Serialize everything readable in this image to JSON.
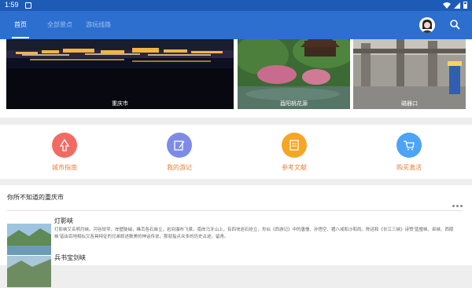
{
  "status_bar": {
    "time": "1:59"
  },
  "tabs": [
    {
      "label": "首页",
      "active": true
    },
    {
      "label": "全部景点",
      "active": false
    },
    {
      "label": "游玩线路",
      "active": false
    }
  ],
  "carousel": [
    {
      "caption": "重庆市"
    },
    {
      "caption": "酉阳桃花源"
    },
    {
      "caption": "磁器口"
    }
  ],
  "features": [
    {
      "label": "城市指南",
      "color": "#f26b63",
      "icon": "city-guide-icon"
    },
    {
      "label": "我的游记",
      "color": "#7d8be8",
      "icon": "travel-notes-icon"
    },
    {
      "label": "参考文献",
      "color": "#f5a623",
      "icon": "references-icon"
    },
    {
      "label": "购买激活",
      "color": "#4da3f5",
      "icon": "cart-icon"
    }
  ],
  "section": {
    "title": "你所不知道的重庆市",
    "items": [
      {
        "name": "灯影峡",
        "desc": "灯影峡又名明月峡。河谷较窄，岸壁陡峭，峰峦各石耸立，岩间瀑布飞泉。南岸马牙山上，有四块岩石屹立，形似《西游记》中的唐僧、孙悟空、猪八戒和沙和尚。陈运和《长江三峡》诗赞'蓝璧峡、巫峡、西陵峡'皆由百地相似又各具特征的兄弟叙述数美的神话传说，那就指点众多的历史古迹，留青。"
      },
      {
        "name": "兵书宝剑峡",
        "desc": ""
      }
    ]
  }
}
